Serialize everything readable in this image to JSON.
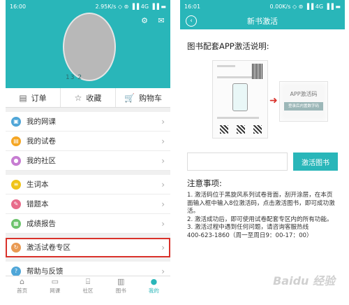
{
  "left": {
    "status": {
      "time": "16:00",
      "right": "2.95K/s ◇ ⊚ ▐▐ 4G ▐▐ ▬"
    },
    "profile": {
      "phone_number": "13         2"
    },
    "top_icons": [
      "gear-icon",
      "mail-icon"
    ],
    "tabs": [
      {
        "icon": "order-icon",
        "label": "订单"
      },
      {
        "icon": "star-icon",
        "label": "收藏"
      },
      {
        "icon": "cart-icon",
        "label": "购物车"
      }
    ],
    "groups": [
      [
        {
          "label": "我的网课",
          "color": "#4fa6d8"
        },
        {
          "label": "我的试卷",
          "color": "#f5a623"
        },
        {
          "label": "我的社区",
          "color": "#c77dd2"
        }
      ],
      [
        {
          "label": "生词本",
          "color": "#f0c419"
        },
        {
          "label": "错题本",
          "color": "#e86b8a"
        },
        {
          "label": "成绩报告",
          "color": "#6cc36c"
        }
      ],
      [
        {
          "label": "激活试卷专区",
          "color": "#e99a53",
          "highlight": true
        }
      ],
      [
        {
          "label": "帮助与反馈",
          "color": "#4fa6d8"
        }
      ]
    ],
    "nav": [
      {
        "label": "首页",
        "active": false
      },
      {
        "label": "网课",
        "active": false
      },
      {
        "label": "社区",
        "active": false
      },
      {
        "label": "图书",
        "active": false
      },
      {
        "label": "我的",
        "active": true
      }
    ]
  },
  "right": {
    "status": {
      "time": "16:01",
      "right": "0.00K/s ◇ ⊚ ▐▐ 4G ▐▐ ▬"
    },
    "header_title": "新书激活",
    "section_title": "图书配套APP激活说明:",
    "illus_code_title": "APP激活码",
    "illus_code_btn": "登录后内置数字码",
    "input_placeholder": "",
    "activate_button": "激活图书",
    "notes_title": "注意事项:",
    "notes_lines": [
      "1. 激活码位于黑旋风系列试卷背面，刮开涂层，在本页",
      "面输入框中输入8位激活码，点击激活图书，即可成功激",
      "活。",
      "2. 激活成功后，即可使用试卷配套专区内的所有功能。",
      "3. 激活过程中遇到任何问题，请咨询客服热线",
      "400-623-1860（周一至周日9：00-17：00）"
    ],
    "watermark": "Baidu 经验"
  }
}
